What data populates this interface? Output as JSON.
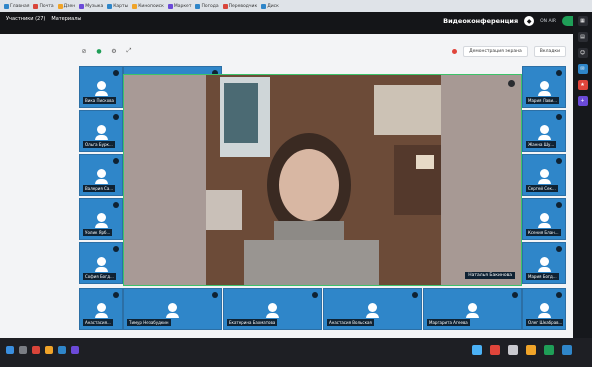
{
  "bookmarks": [
    {
      "label": "Главная",
      "color": "#2f86c9"
    },
    {
      "label": "Почта",
      "color": "#d9453a"
    },
    {
      "label": "Дзен",
      "color": "#f0a429"
    },
    {
      "label": "Музыка",
      "color": "#6b4ad8"
    },
    {
      "label": "Карты",
      "color": "#2f86c9"
    },
    {
      "label": "Кинопоиск",
      "color": "#f0a429"
    },
    {
      "label": "Маркет",
      "color": "#6b4ad8"
    },
    {
      "label": "Погода",
      "color": "#2f86c9"
    },
    {
      "label": "Переводчик",
      "color": "#d9453a"
    },
    {
      "label": "Диск",
      "color": "#2f86c9"
    }
  ],
  "header": {
    "title": "Видеоконференция",
    "status": "ON AIR",
    "participants_tab": "Участники (27)",
    "chat_tab": "Материалы"
  },
  "toolbar": {
    "icons": [
      "camera-off-icon",
      "microphone-icon",
      "settings-icon",
      "expand-icon"
    ],
    "record_label": "Демонстрация экрана",
    "view_label": "Вкладки"
  },
  "left_column_top": [
    {
      "name": "Вика Пискова"
    },
    {
      "name": "Наталья Гусакова"
    }
  ],
  "left_column": [
    {
      "name": "Ольга Бурк..."
    },
    {
      "name": "Валерия Са..."
    },
    {
      "name": "Уолик Ярб..."
    },
    {
      "name": "София Богд..."
    },
    {
      "name": "Анастасия..."
    }
  ],
  "right_column": [
    {
      "name": "Мария Лави..."
    },
    {
      "name": "Жанна Шу..."
    },
    {
      "name": "Сергей Сек..."
    },
    {
      "name": "Ксения Блан..."
    },
    {
      "name": "Мария Богд..."
    },
    {
      "name": "Олег Шкабрав..."
    }
  ],
  "bottom_row": [
    {
      "name": "Тимур Незабудкин"
    },
    {
      "name": "Екатерина Бахматова"
    },
    {
      "name": "Анастасия Вольская"
    },
    {
      "name": "Маргарита Агеева"
    }
  ],
  "main_video": {
    "name": "Наталья Бакинова"
  },
  "sidebar_icons": [
    "apps-icon",
    "folder-icon",
    "people-icon",
    "chat-icon",
    "star-icon",
    "plus-icon"
  ]
}
